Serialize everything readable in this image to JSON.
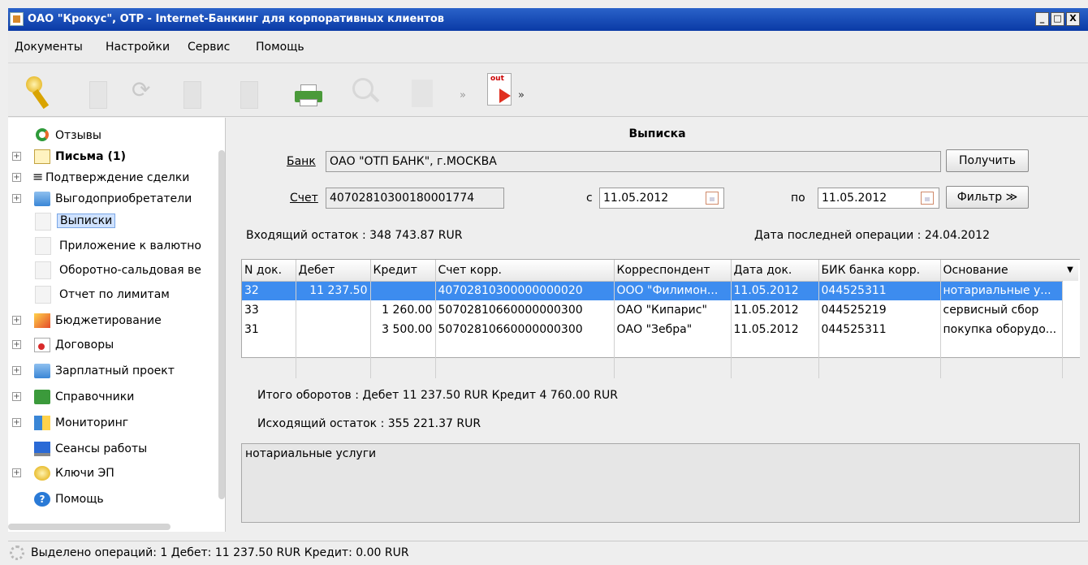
{
  "window": {
    "title": "ОАО \"Крокус\", OTP - Internet-Банкинг для корпоративных клиентов",
    "minimize": "_",
    "maximize": "□",
    "close": "X"
  },
  "menu": [
    "Документы",
    "Настройки",
    "Сервис",
    "Помощь"
  ],
  "toolbar": {
    "icons": [
      "key-icon",
      "new-document-icon",
      "refresh-icon",
      "delete-document-icon",
      "edit-document-icon",
      "print-icon",
      "search-icon",
      "import-icon",
      "export-icon"
    ],
    "import_label": "in",
    "export_label": "out",
    "chevron": "»"
  },
  "sidebar": {
    "items": [
      {
        "label": "Отзывы",
        "icon": "feedback-icon",
        "expandable": false
      },
      {
        "label": "Письма (1)",
        "icon": "mail-icon",
        "expandable": true,
        "bold": true
      },
      {
        "label": "Подтверждение сделки",
        "icon": "document-list-icon",
        "expandable": true
      },
      {
        "label": "Выгодоприобретатели",
        "icon": "folder-icon",
        "expandable": true
      },
      {
        "label": "Выписки",
        "icon": "document-icon",
        "child": true,
        "selected": true
      },
      {
        "label": "Приложение к валютно",
        "icon": "document-icon",
        "child": true
      },
      {
        "label": "Оборотно-сальдовая ве",
        "icon": "document-icon",
        "child": true
      },
      {
        "label": "Отчет по лимитам",
        "icon": "document-icon",
        "child": true
      },
      {
        "label": "Бюджетирование",
        "icon": "chart-icon",
        "expandable": true
      },
      {
        "label": "Договоры",
        "icon": "contract-icon",
        "expandable": true
      },
      {
        "label": "Зарплатный проект",
        "icon": "folder-icon",
        "expandable": true
      },
      {
        "label": "Справочники",
        "icon": "book-icon",
        "expandable": true
      },
      {
        "label": "Мониторинг",
        "icon": "monitoring-icon",
        "expandable": true
      },
      {
        "label": "Сеансы работы",
        "icon": "screen-icon",
        "expandable": false
      },
      {
        "label": "Ключи ЭП",
        "icon": "keys-icon",
        "expandable": true
      },
      {
        "label": "Помощь",
        "icon": "help-icon",
        "expandable": false
      }
    ],
    "expand_glyph": "+"
  },
  "statement": {
    "title": "Выписка",
    "bank_label": "Банк",
    "bank_value": "ОАО \"ОТП БАНК\", г.МОСКВА",
    "account_label": "Счет",
    "account_value": "40702810300180001774",
    "from_label": "с",
    "from_date": "11.05.2012",
    "to_label": "по",
    "to_date": "11.05.2012",
    "get_button": "Получить",
    "filter_button": "Фильтр ≫",
    "opening_balance": "Входящий остаток : 348 743.87  RUR",
    "last_operation": "Дата последней операции : 24.04.2012",
    "totals": "Итого оборотов : Дебет 11 237.50  RUR  Кредит 4 760.00  RUR",
    "closing_balance": "Исходящий остаток : 355 221.37  RUR",
    "description": "нотариальные услуги"
  },
  "table": {
    "columns": [
      "N док.",
      "Дебет",
      "Кредит",
      "Счет корр.",
      "Корреспондент",
      "Дата док.",
      "БИК банка корр.",
      "Основание"
    ],
    "rows": [
      [
        "32",
        "11 237.50",
        "",
        "40702810300000000020",
        "ООО \"Филимон...",
        "11.05.2012",
        "044525311",
        "нотариальные у..."
      ],
      [
        "33",
        "",
        "1 260.00",
        "50702810660000000300",
        "ОАО \"Кипарис\"",
        "11.05.2012",
        "044525219",
        "сервисный сбор"
      ],
      [
        "31",
        "",
        "3 500.00",
        "50702810660000000300",
        "ОАО \"Зебра\"",
        "11.05.2012",
        "044525311",
        "покупка оборудо..."
      ]
    ],
    "selected_row": 0,
    "menu_glyph": "▼"
  },
  "status": {
    "text": "Выделено операций: 1 Дебет: 11 237.50 RUR Кредит: 0.00 RUR"
  }
}
